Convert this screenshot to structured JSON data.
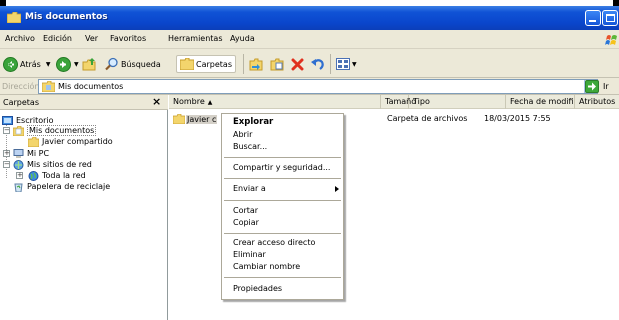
{
  "window": {
    "title": "Mis documentos"
  },
  "menubar": {
    "items": [
      {
        "label": "Archivo"
      },
      {
        "label": "Edición"
      },
      {
        "label": "Ver"
      },
      {
        "label": "Favoritos"
      },
      {
        "label": "Herramientas"
      },
      {
        "label": "Ayuda"
      }
    ]
  },
  "toolbar": {
    "back_label": "Atrás",
    "search_label": "Búsqueda",
    "folders_label": "Carpetas"
  },
  "address": {
    "label": "Dirección",
    "value": "Mis documentos",
    "go_label": "Ir"
  },
  "folders_pane": {
    "title": "Carpetas",
    "close": "×",
    "items": [
      {
        "label": "Escritorio"
      },
      {
        "label": "Mis documentos"
      },
      {
        "label": "Javier compartido"
      },
      {
        "label": "Mi PC"
      },
      {
        "label": "Mis sitios de red"
      },
      {
        "label": "Toda la red"
      },
      {
        "label": "Papelera de reciclaje"
      }
    ]
  },
  "file_list": {
    "columns": [
      {
        "label": "Nombre"
      },
      {
        "label": "Tamaño"
      },
      {
        "label": "Tipo"
      },
      {
        "label": "Fecha de modificación"
      },
      {
        "label": "Atributos"
      }
    ],
    "rows": [
      {
        "name": "Javier c",
        "size": "",
        "type": "Carpeta de archivos",
        "modified": "18/03/2015 7:55",
        "attributes": ""
      }
    ]
  },
  "context_menu": {
    "items": [
      {
        "label": "Explorar"
      },
      {
        "label": "Abrir"
      },
      {
        "label": "Buscar..."
      },
      {
        "label": "Compartir y seguridad..."
      },
      {
        "label": "Enviar a"
      },
      {
        "label": "Cortar"
      },
      {
        "label": "Copiar"
      },
      {
        "label": "Crear acceso directo"
      },
      {
        "label": "Eliminar"
      },
      {
        "label": "Cambiar nombre"
      },
      {
        "label": "Propiedades"
      }
    ]
  },
  "colors": {
    "titlebar": "#0a46cc",
    "chrome": "#ece9d8",
    "folder": "#f2d26b",
    "go_green": "#3da83a"
  }
}
